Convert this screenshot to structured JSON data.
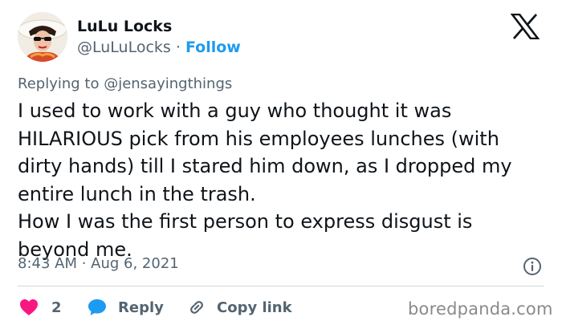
{
  "author": {
    "name": "LuLu Locks",
    "handle": "@LuLuLocks",
    "separator": "·",
    "follow_label": "Follow"
  },
  "reply_context": "Replying to @jensayingthings",
  "tweet": {
    "paragraphs": [
      "I used to work with a guy who thought it was HILARIOUS pick from his employees lunches (with dirty hands) till I stared him down, as I dropped my entire lunch in the trash.",
      "How I was the first person to express disgust is beyond me."
    ]
  },
  "timestamp": "8:43 AM · Aug 6, 2021",
  "actions": {
    "like_count": "2",
    "reply_label": "Reply",
    "copy_link_label": "Copy link"
  },
  "watermark": "boredpanda.com",
  "icons": {
    "logo": "x-logo-icon",
    "like": "heart-icon",
    "reply": "speech-bubble-icon",
    "copy": "link-icon",
    "info": "info-icon"
  },
  "colors": {
    "accent": "#1d9bf0",
    "like": "#f91880",
    "text": "#0f1419",
    "muted": "#536471",
    "divider": "#cfd9de"
  }
}
